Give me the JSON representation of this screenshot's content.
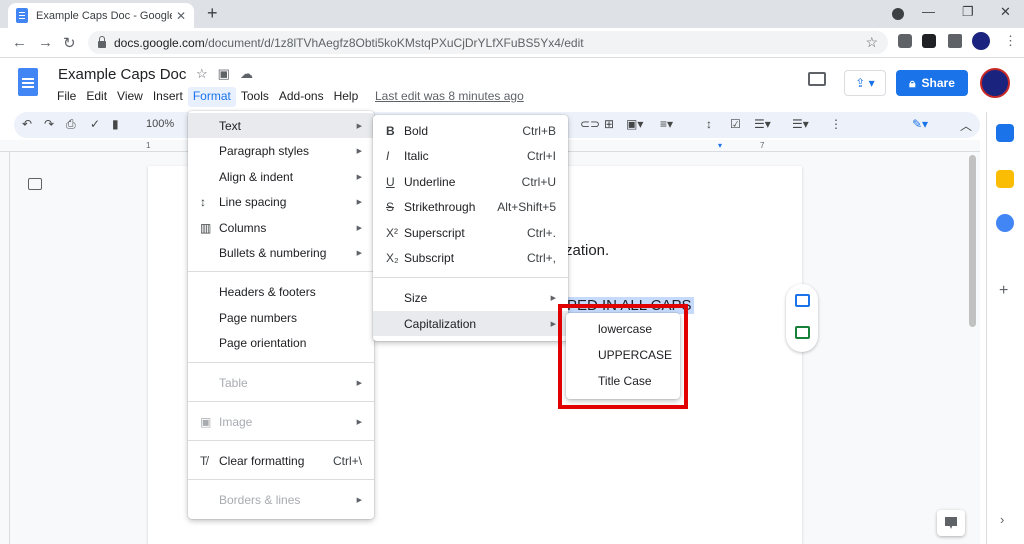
{
  "browser": {
    "tab_title": "Example Caps Doc - Google Docs",
    "new_tab": "+",
    "url_host": "docs.google.com",
    "url_path": "/document/d/1z8lTVhAegfz8Obti5koKMstqPXuCjDrYLfXFuBS5Yx4/edit",
    "back": "←",
    "forward": "→",
    "reload": "↻",
    "bookmark": "☆",
    "minimize": "—",
    "restore": "❐",
    "close": "✕"
  },
  "docs": {
    "title": "Example Caps Doc",
    "menu": [
      "File",
      "Edit",
      "View",
      "Insert",
      "Format",
      "Tools",
      "Add-ons",
      "Help"
    ],
    "last_edit": "Last edit was 8 minutes ago",
    "share": "Share",
    "zoom": "100%",
    "page_text_1": "zation.",
    "page_text_2": "PED IN ALL CAPS"
  },
  "ruler_marks": [
    "1",
    "7"
  ],
  "format_menu": {
    "text": "Text",
    "paragraph_styles": "Paragraph styles",
    "align_indent": "Align & indent",
    "line_spacing": "Line spacing",
    "columns": "Columns",
    "bullets": "Bullets & numbering",
    "headers_footers": "Headers & footers",
    "page_numbers": "Page numbers",
    "page_orientation": "Page orientation",
    "table": "Table",
    "image": "Image",
    "clear_formatting": "Clear formatting",
    "clear_shortcut": "Ctrl+\\",
    "borders_lines": "Borders & lines"
  },
  "text_menu": {
    "bold": "Bold",
    "bold_sc": "Ctrl+B",
    "italic": "Italic",
    "italic_sc": "Ctrl+I",
    "underline": "Underline",
    "underline_sc": "Ctrl+U",
    "strikethrough": "Strikethrough",
    "strikethrough_sc": "Alt+Shift+5",
    "superscript": "Superscript",
    "superscript_sc": "Ctrl+.",
    "subscript": "Subscript",
    "subscript_sc": "Ctrl+,",
    "size": "Size",
    "capitalization": "Capitalization"
  },
  "cap_menu": {
    "lowercase": "lowercase",
    "uppercase": "UPPERCASE",
    "titlecase": "Title Case"
  },
  "colors": {
    "accent": "#1a73e8",
    "highlight_box": "#e00000"
  }
}
